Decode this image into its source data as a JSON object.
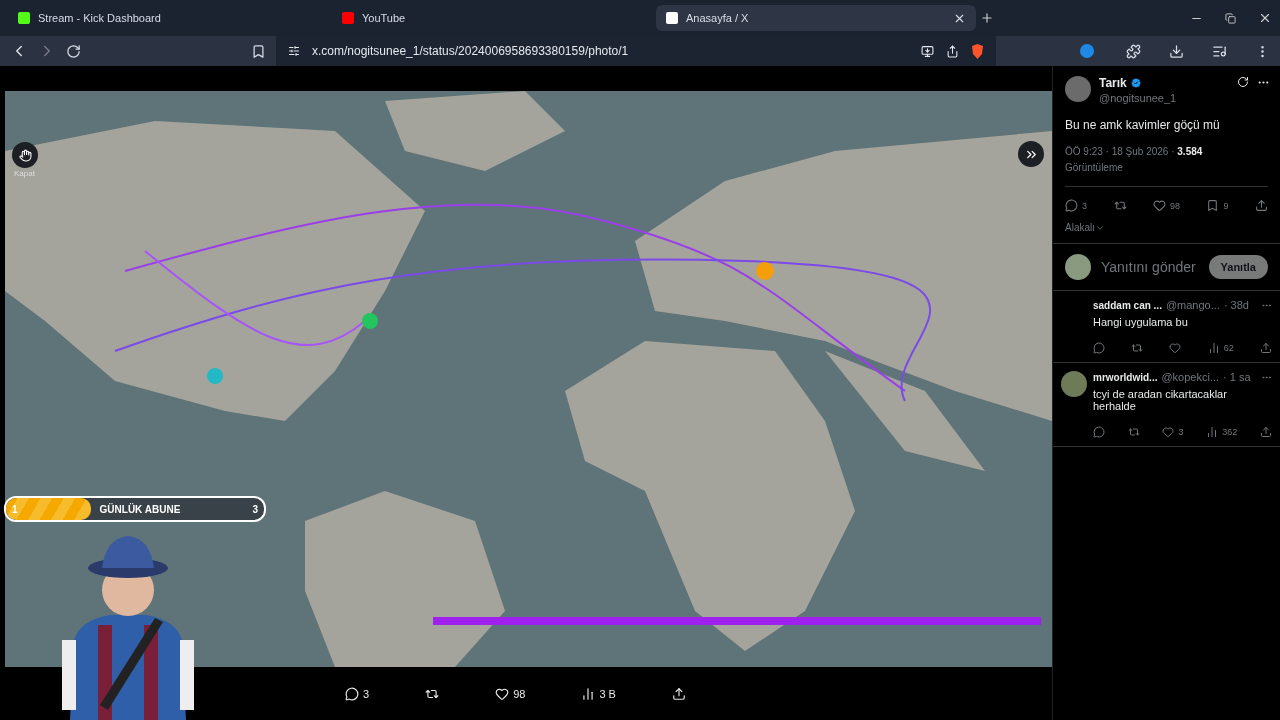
{
  "browser": {
    "tabs": [
      {
        "title": "Stream - Kick Dashboard",
        "selected": false,
        "kind": "kick"
      },
      {
        "title": "YouTube",
        "selected": false,
        "kind": "youtube"
      },
      {
        "title": "Anasayfa / X",
        "selected": true,
        "kind": "x"
      }
    ],
    "address": "x.com/nogitsunee_1/status/2024006958693380159/photo/1"
  },
  "viewer": {
    "close_tooltip": "Kapat",
    "actions": [
      {
        "kind": "reply",
        "count": "3"
      },
      {
        "kind": "repost"
      },
      {
        "kind": "like",
        "count": "98"
      },
      {
        "kind": "views",
        "count": "3 B"
      },
      {
        "kind": "share"
      }
    ]
  },
  "stream_overlay": {
    "goal": {
      "current": "1",
      "label": "GÜNLÜK ABUNE",
      "target": "3",
      "level": 0.33
    }
  },
  "post": {
    "name": "Tarık",
    "verified": true,
    "handle": "@nogitsunee_1",
    "text": "Bu ne amk kavimler göçü mü",
    "time": "ÖÖ 9:23 · 18 Şub 2026 · ",
    "views": "3.584",
    "views_label": "Görüntüleme",
    "stats": [
      {
        "kind": "reply",
        "count": "3"
      },
      {
        "kind": "repost"
      },
      {
        "kind": "like",
        "count": "98"
      },
      {
        "kind": "bookmark",
        "count": "9"
      },
      {
        "kind": "share"
      }
    ],
    "sort": "Alakalı",
    "reply_placeholder": "Yanıtını gönder",
    "reply_button": "Yanıtla"
  },
  "replies": [
    {
      "name": "saddam can ...",
      "handle": "@mango...",
      "time": "· 38d",
      "text": "Hangi uygulama bu",
      "has_avatar": false,
      "views": "62"
    },
    {
      "name": "mrworldwid...",
      "handle": "@kopekci...",
      "time": "· 1 sa",
      "text": "tcyi de aradan cikartacaklar herhalde",
      "has_avatar": true,
      "likes": "3",
      "views": "362"
    }
  ]
}
